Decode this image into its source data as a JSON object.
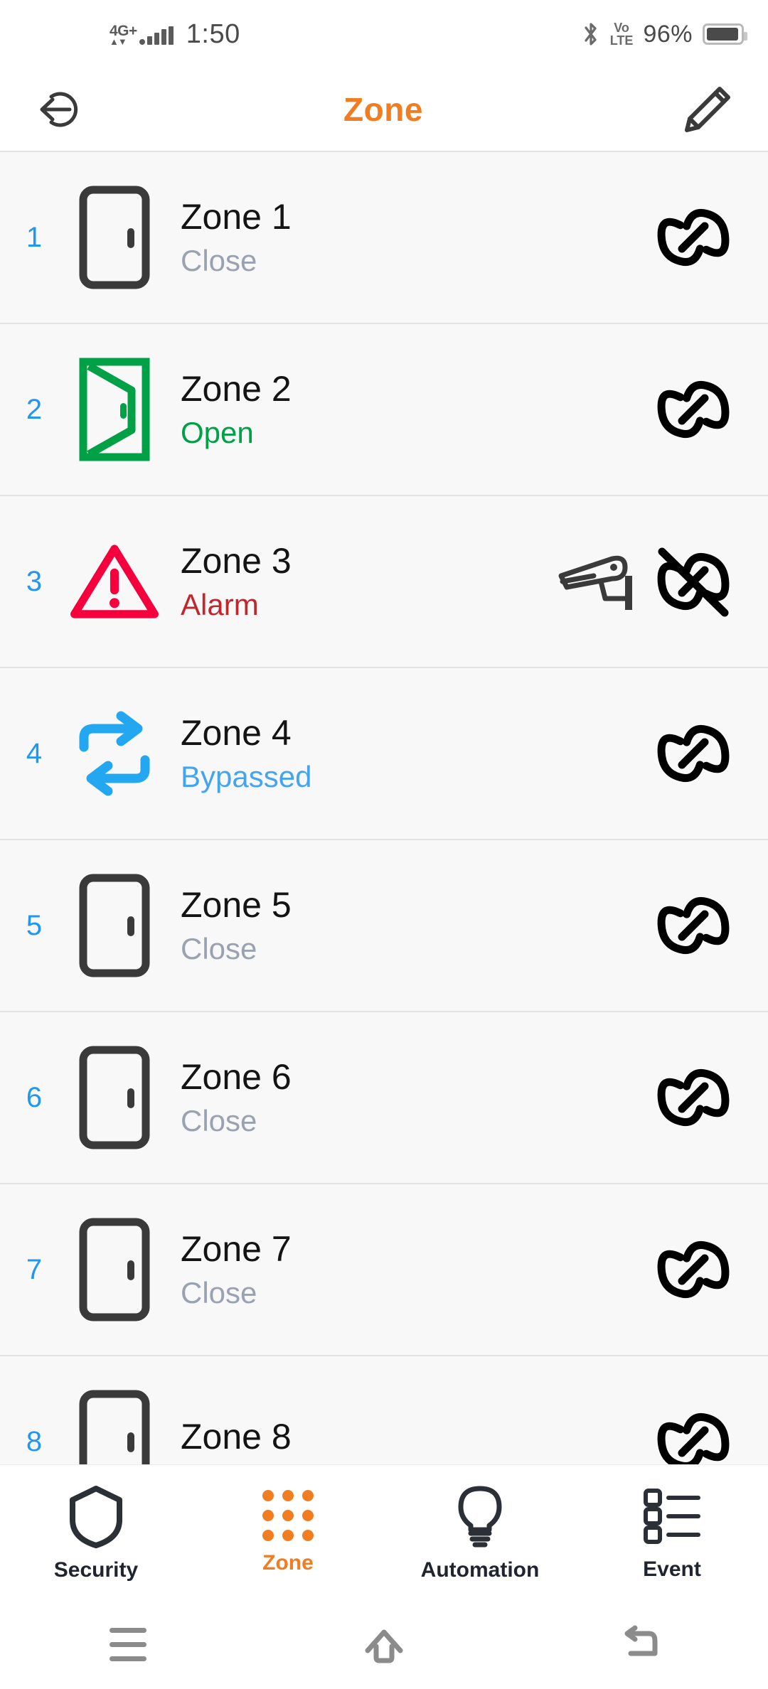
{
  "status_bar": {
    "network_label": "4G+",
    "time": "1:50",
    "volte_top": "Vo",
    "volte_bottom": "LTE",
    "battery_percent": "96%",
    "icons": [
      "signal-bars-icon",
      "bluetooth-icon",
      "volte-icon",
      "battery-icon"
    ]
  },
  "header": {
    "title": "Zone",
    "back_icon": "back-arrow-circle-icon",
    "edit_icon": "pencil-edit-icon",
    "title_color": "#f07d22"
  },
  "zones": [
    {
      "number": "1",
      "name": "Zone 1",
      "state": "Close",
      "state_class": "st-close",
      "icon": "door-closed-icon",
      "icon_color": "#3a3a3a",
      "camera": false,
      "link": "linked"
    },
    {
      "number": "2",
      "name": "Zone 2",
      "state": "Open",
      "state_class": "st-open",
      "icon": "door-open-icon",
      "icon_color": "#00a046",
      "camera": false,
      "link": "linked"
    },
    {
      "number": "3",
      "name": "Zone 3",
      "state": "Alarm",
      "state_class": "st-alarm",
      "icon": "alarm-warning-icon",
      "icon_color": "#f5003c",
      "camera": true,
      "link": "unlinked"
    },
    {
      "number": "4",
      "name": "Zone 4",
      "state": "Bypassed",
      "state_class": "st-bypassed",
      "icon": "bypass-arrows-icon",
      "icon_color": "#22a7f0",
      "camera": false,
      "link": "linked"
    },
    {
      "number": "5",
      "name": "Zone 5",
      "state": "Close",
      "state_class": "st-close",
      "icon": "door-closed-icon",
      "icon_color": "#3a3a3a",
      "camera": false,
      "link": "linked"
    },
    {
      "number": "6",
      "name": "Zone 6",
      "state": "Close",
      "state_class": "st-close",
      "icon": "door-closed-icon",
      "icon_color": "#3a3a3a",
      "camera": false,
      "link": "linked"
    },
    {
      "number": "7",
      "name": "Zone 7",
      "state": "Close",
      "state_class": "st-close",
      "icon": "door-closed-icon",
      "icon_color": "#3a3a3a",
      "camera": false,
      "link": "linked"
    },
    {
      "number": "8",
      "name": "Zone 8",
      "state": "",
      "state_class": "st-close",
      "icon": "door-closed-icon",
      "icon_color": "#3a3a3a",
      "camera": false,
      "link": "linked"
    }
  ],
  "tabs": [
    {
      "label": "Security",
      "icon": "shield-icon",
      "active": false
    },
    {
      "label": "Zone",
      "icon": "grid-dots-icon",
      "active": true
    },
    {
      "label": "Automation",
      "icon": "lightbulb-icon",
      "active": false
    },
    {
      "label": "Event",
      "icon": "list-icon",
      "active": false
    }
  ],
  "nav_bar": {
    "recents_icon": "hamburger-recents-icon",
    "home_icon": "home-icon",
    "back_icon": "back-icon"
  },
  "colors": {
    "accent": "#f07d22",
    "number_blue": "#2196f3",
    "open_green": "#00a046",
    "alarm_red": "#c0272d",
    "bypass_blue": "#43a5f0",
    "close_gray": "#9aa2b1"
  }
}
